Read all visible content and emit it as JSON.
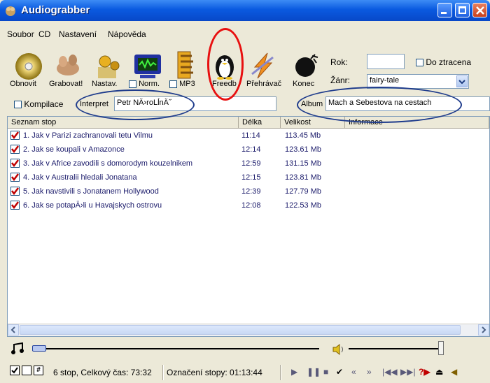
{
  "window": {
    "title": "Audiograbber"
  },
  "menu": [
    "Soubor",
    "CD",
    "Nastavení",
    "Nápověda"
  ],
  "toolbar": {
    "refresh": "Obnovit",
    "grab": "Grabovat!",
    "settings": "Nastav.",
    "norm": "Norm.",
    "mp3": "MP3",
    "freedb": "Freedb",
    "player": "Přehrávač",
    "exit": "Konec"
  },
  "meta": {
    "year_label": "Rok:",
    "year_value": "",
    "lost_label": "Do ztracena",
    "genre_label": "Žánr:",
    "genre_value": "fairy-tale",
    "compilation_label": "Kompilace",
    "artist_label": "Interpret",
    "artist_value": "Petr NÄ›roLĺnÄ˝",
    "album_label": "Album",
    "album_value": "Mach a Sebestova na cestach"
  },
  "table": {
    "headers": [
      "Seznam stop",
      "Délka",
      "Velikost",
      "Informace"
    ],
    "rows": [
      {
        "title": "1. Jak v Parizi zachranovali tetu Vilmu",
        "length": "11:14",
        "size": "113.45 Mb",
        "checked": true
      },
      {
        "title": "2. Jak se koupali v Amazonce",
        "length": "12:14",
        "size": "123.61 Mb",
        "checked": true
      },
      {
        "title": "3. Jak v Africe zavodili s domorodym kouzelnikem",
        "length": "12:59",
        "size": "131.15 Mb",
        "checked": true
      },
      {
        "title": "4. Jak v Australii hledali Jonatana",
        "length": "12:15",
        "size": "123.81 Mb",
        "checked": true
      },
      {
        "title": "5. Jak navstivili s Jonatanem Hollywood",
        "length": "12:39",
        "size": "127.79 Mb",
        "checked": true
      },
      {
        "title": "6. Jak se potapÄ›li u Havajskych ostrovu",
        "length": "12:08",
        "size": "122.53 Mb",
        "checked": true
      }
    ]
  },
  "status": {
    "summary": "6 stop, Celkový čas: 73:32",
    "selected": "Označení stopy: 01:13:44"
  },
  "colors": {
    "titlebar": "#0a5ae0",
    "track_text": "#1a1a6a",
    "annotation_red": "#e81010",
    "annotation_blue": "#1f3c8c"
  }
}
